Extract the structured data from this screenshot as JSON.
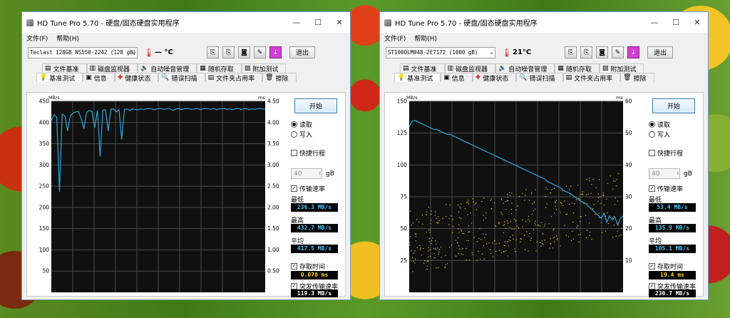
{
  "windows": [
    {
      "title": "HD Tune Pro 5.70 - 硬盘/固态硬盘实用程序",
      "menu": [
        "文件(F)",
        "帮助(H)"
      ],
      "drive": "Teclast 128GB NS550-2242 (128 gB)",
      "temperature": "— °C",
      "exit_label": "退出",
      "tabs_row1": [
        {
          "label": "文件基准",
          "icon": "file-benchmark-icon"
        },
        {
          "label": "磁盘监视器",
          "icon": "disk-monitor-icon"
        },
        {
          "label": "自动噪音管理",
          "icon": "aam-icon"
        },
        {
          "label": "随机存取",
          "icon": "random-access-icon"
        },
        {
          "label": "附加测试",
          "icon": "extra-tests-icon"
        }
      ],
      "tabs_row2": [
        {
          "label": "基准测试",
          "icon": "benchmark-icon",
          "active": true
        },
        {
          "label": "信息",
          "icon": "info-icon"
        },
        {
          "label": "健康状态",
          "icon": "health-icon"
        },
        {
          "label": "错误扫描",
          "icon": "error-scan-icon"
        },
        {
          "label": "文件夹占用率",
          "icon": "folder-usage-icon"
        },
        {
          "label": "擦除",
          "icon": "erase-icon"
        }
      ],
      "side": {
        "start_label": "开始",
        "read_label": "读取",
        "write_label": "写入",
        "mode": "read",
        "short_stroke_label": "快捷行程",
        "short_stroke_checked": false,
        "short_stroke_value": "40",
        "short_stroke_unit": "gB",
        "transfer_rate_label": "传输速率",
        "transfer_rate_checked": true,
        "min_label": "最低",
        "min_value": "236.3 MB/s",
        "max_label": "最高",
        "max_value": "432.7 MB/s",
        "avg_label": "平均",
        "avg_value": "417.5 MB/s",
        "access_time_label": "存取时间",
        "access_time_checked": true,
        "access_time_value": "0.070 ms",
        "burst_rate_label": "突发传输速率",
        "burst_rate_checked": true,
        "burst_rate_value": "119.3 MB/s"
      },
      "chart_data": {
        "type": "line",
        "left_unit": "MB/s",
        "right_unit": "ms",
        "ylim": [
          0,
          450
        ],
        "y_ticks": [
          "450",
          "400",
          "350",
          "300",
          "250",
          "200",
          "150",
          "100",
          "50"
        ],
        "y2lim": [
          0,
          4.5
        ],
        "y2_ticks": [
          "4.50",
          "4.00",
          "3.50",
          "3.00",
          "2.50",
          "2.00",
          "1.50",
          "1.00",
          "0.50"
        ],
        "grid": true,
        "series": [
          {
            "values": [
              405,
              418,
              412,
              236,
              420,
              415,
              380,
              416,
              422,
              425,
              426,
              410,
              385,
              424,
              428,
              426,
              388,
              428,
              320,
              429,
              430,
              380,
              431,
              432,
              425,
              430,
              360,
              431,
              432,
              428,
              432,
              431,
              430,
              432,
              431,
              432,
              433,
              432,
              430,
              432,
              433,
              432,
              431,
              433,
              432,
              428,
              432,
              433,
              430,
              432,
              433,
              432,
              431,
              432,
              433,
              430,
              432,
              433,
              432,
              431,
              433,
              430,
              432,
              432,
              433,
              431,
              432,
              430,
              432,
              433,
              431,
              432,
              433,
              430,
              432,
              431,
              432,
              433,
              432,
              431
            ]
          }
        ],
        "scatter_ms": []
      }
    },
    {
      "title": "HD Tune Pro 5.70 - 硬盘/固态硬盘实用程序",
      "menu": [
        "文件(F)",
        "帮助(H)"
      ],
      "drive": "ST1000LM048-2E7172 (1000 gB)",
      "temperature": "21°C",
      "exit_label": "退出",
      "tabs_row1": [
        {
          "label": "文件基准",
          "icon": "file-benchmark-icon"
        },
        {
          "label": "磁盘监视器",
          "icon": "disk-monitor-icon"
        },
        {
          "label": "自动噪音管理",
          "icon": "aam-icon"
        },
        {
          "label": "随机存取",
          "icon": "random-access-icon"
        },
        {
          "label": "附加测试",
          "icon": "extra-tests-icon"
        }
      ],
      "tabs_row2": [
        {
          "label": "基准测试",
          "icon": "benchmark-icon",
          "active": true
        },
        {
          "label": "信息",
          "icon": "info-icon"
        },
        {
          "label": "健康状态",
          "icon": "health-icon"
        },
        {
          "label": "错误扫描",
          "icon": "error-scan-icon"
        },
        {
          "label": "文件夹占用率",
          "icon": "folder-usage-icon"
        },
        {
          "label": "擦除",
          "icon": "erase-icon"
        }
      ],
      "side": {
        "start_label": "开始",
        "read_label": "读取",
        "write_label": "写入",
        "mode": "read",
        "short_stroke_label": "快捷行程",
        "short_stroke_checked": false,
        "short_stroke_value": "40",
        "short_stroke_unit": "gB",
        "transfer_rate_label": "传输速率",
        "transfer_rate_checked": true,
        "min_label": "最低",
        "min_value": "53.4 MB/s",
        "max_label": "最高",
        "max_value": "135.9 MB/s",
        "avg_label": "平均",
        "avg_value": "105.1 MB/s",
        "access_time_label": "存取时间",
        "access_time_checked": true,
        "access_time_value": "19.4 ms",
        "burst_rate_label": "突发传输速率",
        "burst_rate_checked": true,
        "burst_rate_value": "230.7 MB/s"
      },
      "chart_data": {
        "type": "line",
        "left_unit": "MB/s",
        "right_unit": "ms",
        "ylim": [
          0,
          150
        ],
        "y_ticks": [
          "150",
          "125",
          "100",
          "75",
          "50",
          "25"
        ],
        "y2lim": [
          0,
          60
        ],
        "y2_ticks": [
          "60",
          "50",
          "40",
          "30",
          "20",
          "10"
        ],
        "grid": true,
        "series": [
          {
            "values": [
              130,
              134,
              135,
              134,
              133,
              132,
              131,
              130,
              129,
              128,
              128,
              127,
              126,
              125,
              124,
              124,
              123,
              122,
              121,
              120,
              119,
              118,
              117,
              116,
              115,
              114,
              113,
              112,
              111,
              110,
              109,
              108,
              107,
              106,
              105,
              104,
              103,
              102,
              101,
              100,
              99,
              98,
              97,
              96,
              95,
              94,
              93,
              92,
              91,
              90,
              89,
              87,
              86,
              85,
              84,
              83,
              82,
              80,
              79,
              78,
              77,
              75,
              74,
              72,
              71,
              70,
              68,
              66,
              64,
              62,
              60,
              58,
              62,
              55,
              60,
              57,
              59,
              53,
              58,
              60
            ]
          }
        ],
        "scatter_ms": "access-times"
      }
    }
  ]
}
